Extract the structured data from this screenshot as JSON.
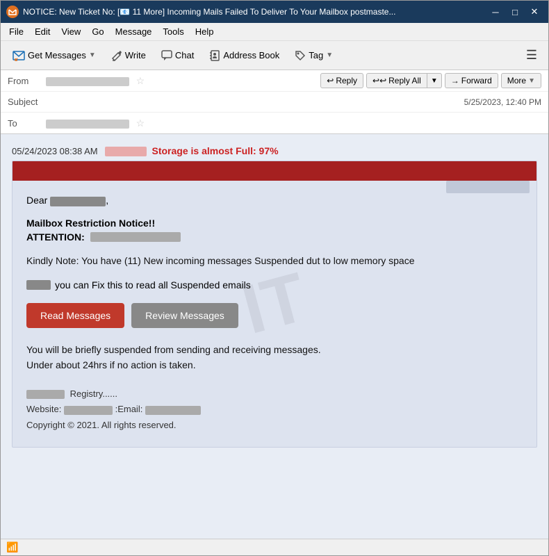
{
  "window": {
    "title": "NOTICE: New Ticket No: [📧 11 More] Incoming Mails Failed To Deliver To Your Mailbox postmaste...",
    "icon": "📧"
  },
  "titlebar": {
    "minimize_label": "─",
    "maximize_label": "□",
    "close_label": "✕"
  },
  "menubar": {
    "items": [
      "File",
      "Edit",
      "View",
      "Go",
      "Message",
      "Tools",
      "Help"
    ]
  },
  "toolbar": {
    "get_messages_label": "Get Messages",
    "write_label": "Write",
    "chat_label": "Chat",
    "address_book_label": "Address Book",
    "tag_label": "Tag"
  },
  "header": {
    "from_label": "From",
    "subject_label": "Subject",
    "to_label": "To",
    "subject_text": "NOTICE: New Ticket No: [📧 11 More] Incoming Mails Failed To Deliver To Your Mailbox",
    "date_text": "5/25/2023, 12:40 PM",
    "reply_label": "Reply",
    "reply_all_label": "Reply All",
    "forward_label": "Forward",
    "more_label": "More"
  },
  "email": {
    "date_line": "05/24/2023 08:38 AM",
    "storage_warning": "Storage is almost Full: 97%",
    "dear_line": "Dear",
    "notice_title": "Mailbox Restriction Notice!!",
    "attention_label": "ATTENTION:",
    "body_text": "Kindly Note: You have (11) New  incoming messages Suspended dut to low memory space",
    "fix_text": "you can Fix this to read all Suspended emails",
    "read_messages_label": "Read Messages",
    "review_messages_label": "Review Messages",
    "suspend_text_line1": "You will be briefly suspended from sending and receiving messages.",
    "suspend_text_line2": "Under about 24hrs if no action is taken.",
    "footer_registry": "Registry......",
    "footer_website_label": "Website:",
    "footer_email_label": ":Email:",
    "footer_copyright": "Copyright © 2021. All rights reserved."
  },
  "statusbar": {
    "wifi_icon": "📶"
  }
}
